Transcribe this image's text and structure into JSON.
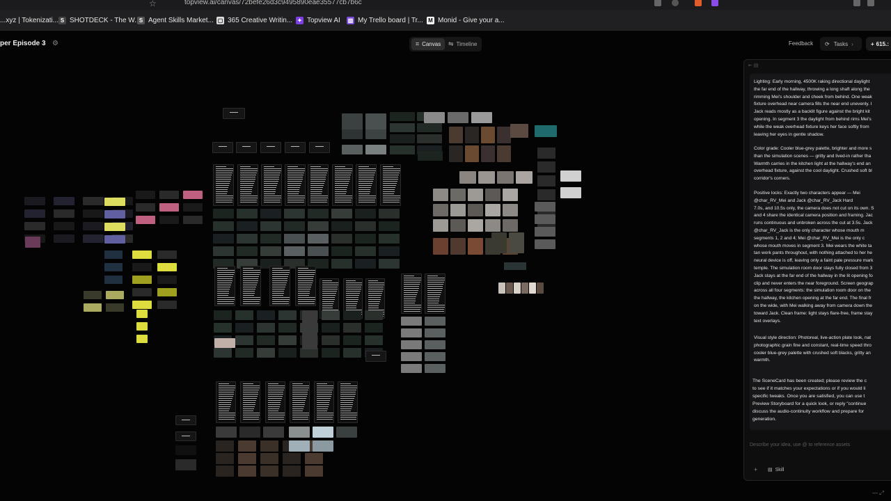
{
  "browser": {
    "url": "topview.ai/canvas/72befe26d3c9495890eae35577cb7b6c",
    "bookmarks": [
      {
        "label": "...xyz | Tokenizati...",
        "icon": "bookmark-icon",
        "color": "#3a7bd5"
      },
      {
        "label": "SHOTDECK - The W...",
        "icon": "shotdeck-icon",
        "color": "#444444"
      },
      {
        "label": "Agent Skills Market...",
        "icon": "agent-skills-icon",
        "color": "#555555"
      },
      {
        "label": "365 Creative Writin...",
        "icon": "365-icon",
        "color": "#dddddd"
      },
      {
        "label": "Topview AI",
        "icon": "topview-icon",
        "color": "#7b3fe4"
      },
      {
        "label": "My Trello board | Tr...",
        "icon": "trello-icon",
        "color": "#7c4ad9"
      },
      {
        "label": "Monid - Give your a...",
        "icon": "monid-icon",
        "color": "#ffffff"
      }
    ]
  },
  "header": {
    "project_title": "per Episode 3",
    "view_tabs": [
      {
        "label": "Canvas",
        "active": true
      },
      {
        "label": "Timeline",
        "active": false
      }
    ],
    "feedback_label": "Feedback",
    "tasks_label": "Tasks",
    "credits_label": "615.:"
  },
  "chat": {
    "paragraphs": [
      "Lighting: Early morning, 4500K raking directional daylight\nthe far end of the hallway, throwing a long shaft along the\nrimming Mei's shoulder and cheek from behind. One weak\nfixture overhead near camera fills the near end unevenly. I\nJack reads mostly as a backlit figure against the bright kit\nopening. In segment 3 the daylight from behind rims Mei's\nwhile the weak overhead fixture keys her face softly from\nleaving her eyes in gentle shadow.",
      "Color grade: Cooler blue-grey palette, brighter and more s\nthan the simulation scenes — gritty and lived-in rather tha\nWarmth carries in the kitchen light at the hallway's end an\noverhead fixture, against the cool daylight. Crushed soft bl\ncorridor's corners.",
      "Positive locks: Exactly two characters appear — Mei\n@char_RV_Mei  and Jack  @char_RV_Jack  Hard\n7.0s, and 10.5s only, the camera does not cut on its own. S\nand 4 share the identical camera position and framing. Jac\nruns continuous and unbroken across the cut at 3.5s. Jack\n@char_RV_Jack  is the only character whose mouth m\nsegments 1, 2 and 4; Mei  @char_RV_Mei  is the only c\nwhose mouth moves in segment 3. Mei wears the white ta\ntan work pants throughout, with nothing attached to her he\nneural device is off, leaving only a faint pale pressure mark\ntemple. The simulation room door stays fully closed from 3\nJack stays at the far end of the hallway in the lit opening fo\nclip and never enters the near foreground. Screen geograp\nacross all four segments: the simulation room door on the\nthe hallway, the kitchen opening at the far end. The final fr\non the wide, with Mei walking away from camera down the\ntoward Jack. Clean frame: light stays flare-free, frame stay\ntext overlays.",
      "Visual style direction: Photoreal, live-action plate look, nat\nphotographic grain fine and constant, real-time speed thro\ncooler blue-grey palette with crushed soft blacks, gritty an\nwarmth."
    ],
    "closing_message": "The SceneCard has been created; please review the c\nto see if it matches your expectations or if you would li\nspecific tweaks. Once you are satisfied, you can use t\nPreview Storyboard for a quick look, or reply \"continue\ndiscuss the audio-continuity workflow and prepare for\ngeneration.",
    "input_placeholder": "Describe your idea, use @ to reference assets",
    "skill_label": "Skill"
  }
}
